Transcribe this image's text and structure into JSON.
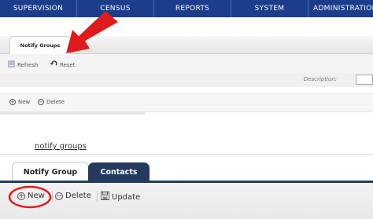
{
  "nav": {
    "items": [
      "SUPERVISION",
      "CENSUS",
      "REPORTS",
      "SYSTEM",
      "ADMINISTRATION"
    ]
  },
  "upper": {
    "tab_label": "Notify Groups",
    "refresh_label": "Refresh",
    "reset_label": "Reset",
    "description_label": "Description:",
    "new_label": "New",
    "delete_label": "Delete"
  },
  "lower": {
    "link_text": "notify groups",
    "tabs": [
      {
        "label": "Notify Group"
      },
      {
        "label": "Contacts"
      }
    ],
    "toolbar": {
      "new_label": "New",
      "delete_label": "Delete",
      "update_label": "Update"
    }
  },
  "colors": {
    "nav_bg": "#1c3d8a",
    "tab_dark": "#233a5e",
    "annotation_red": "#e01b1b"
  }
}
